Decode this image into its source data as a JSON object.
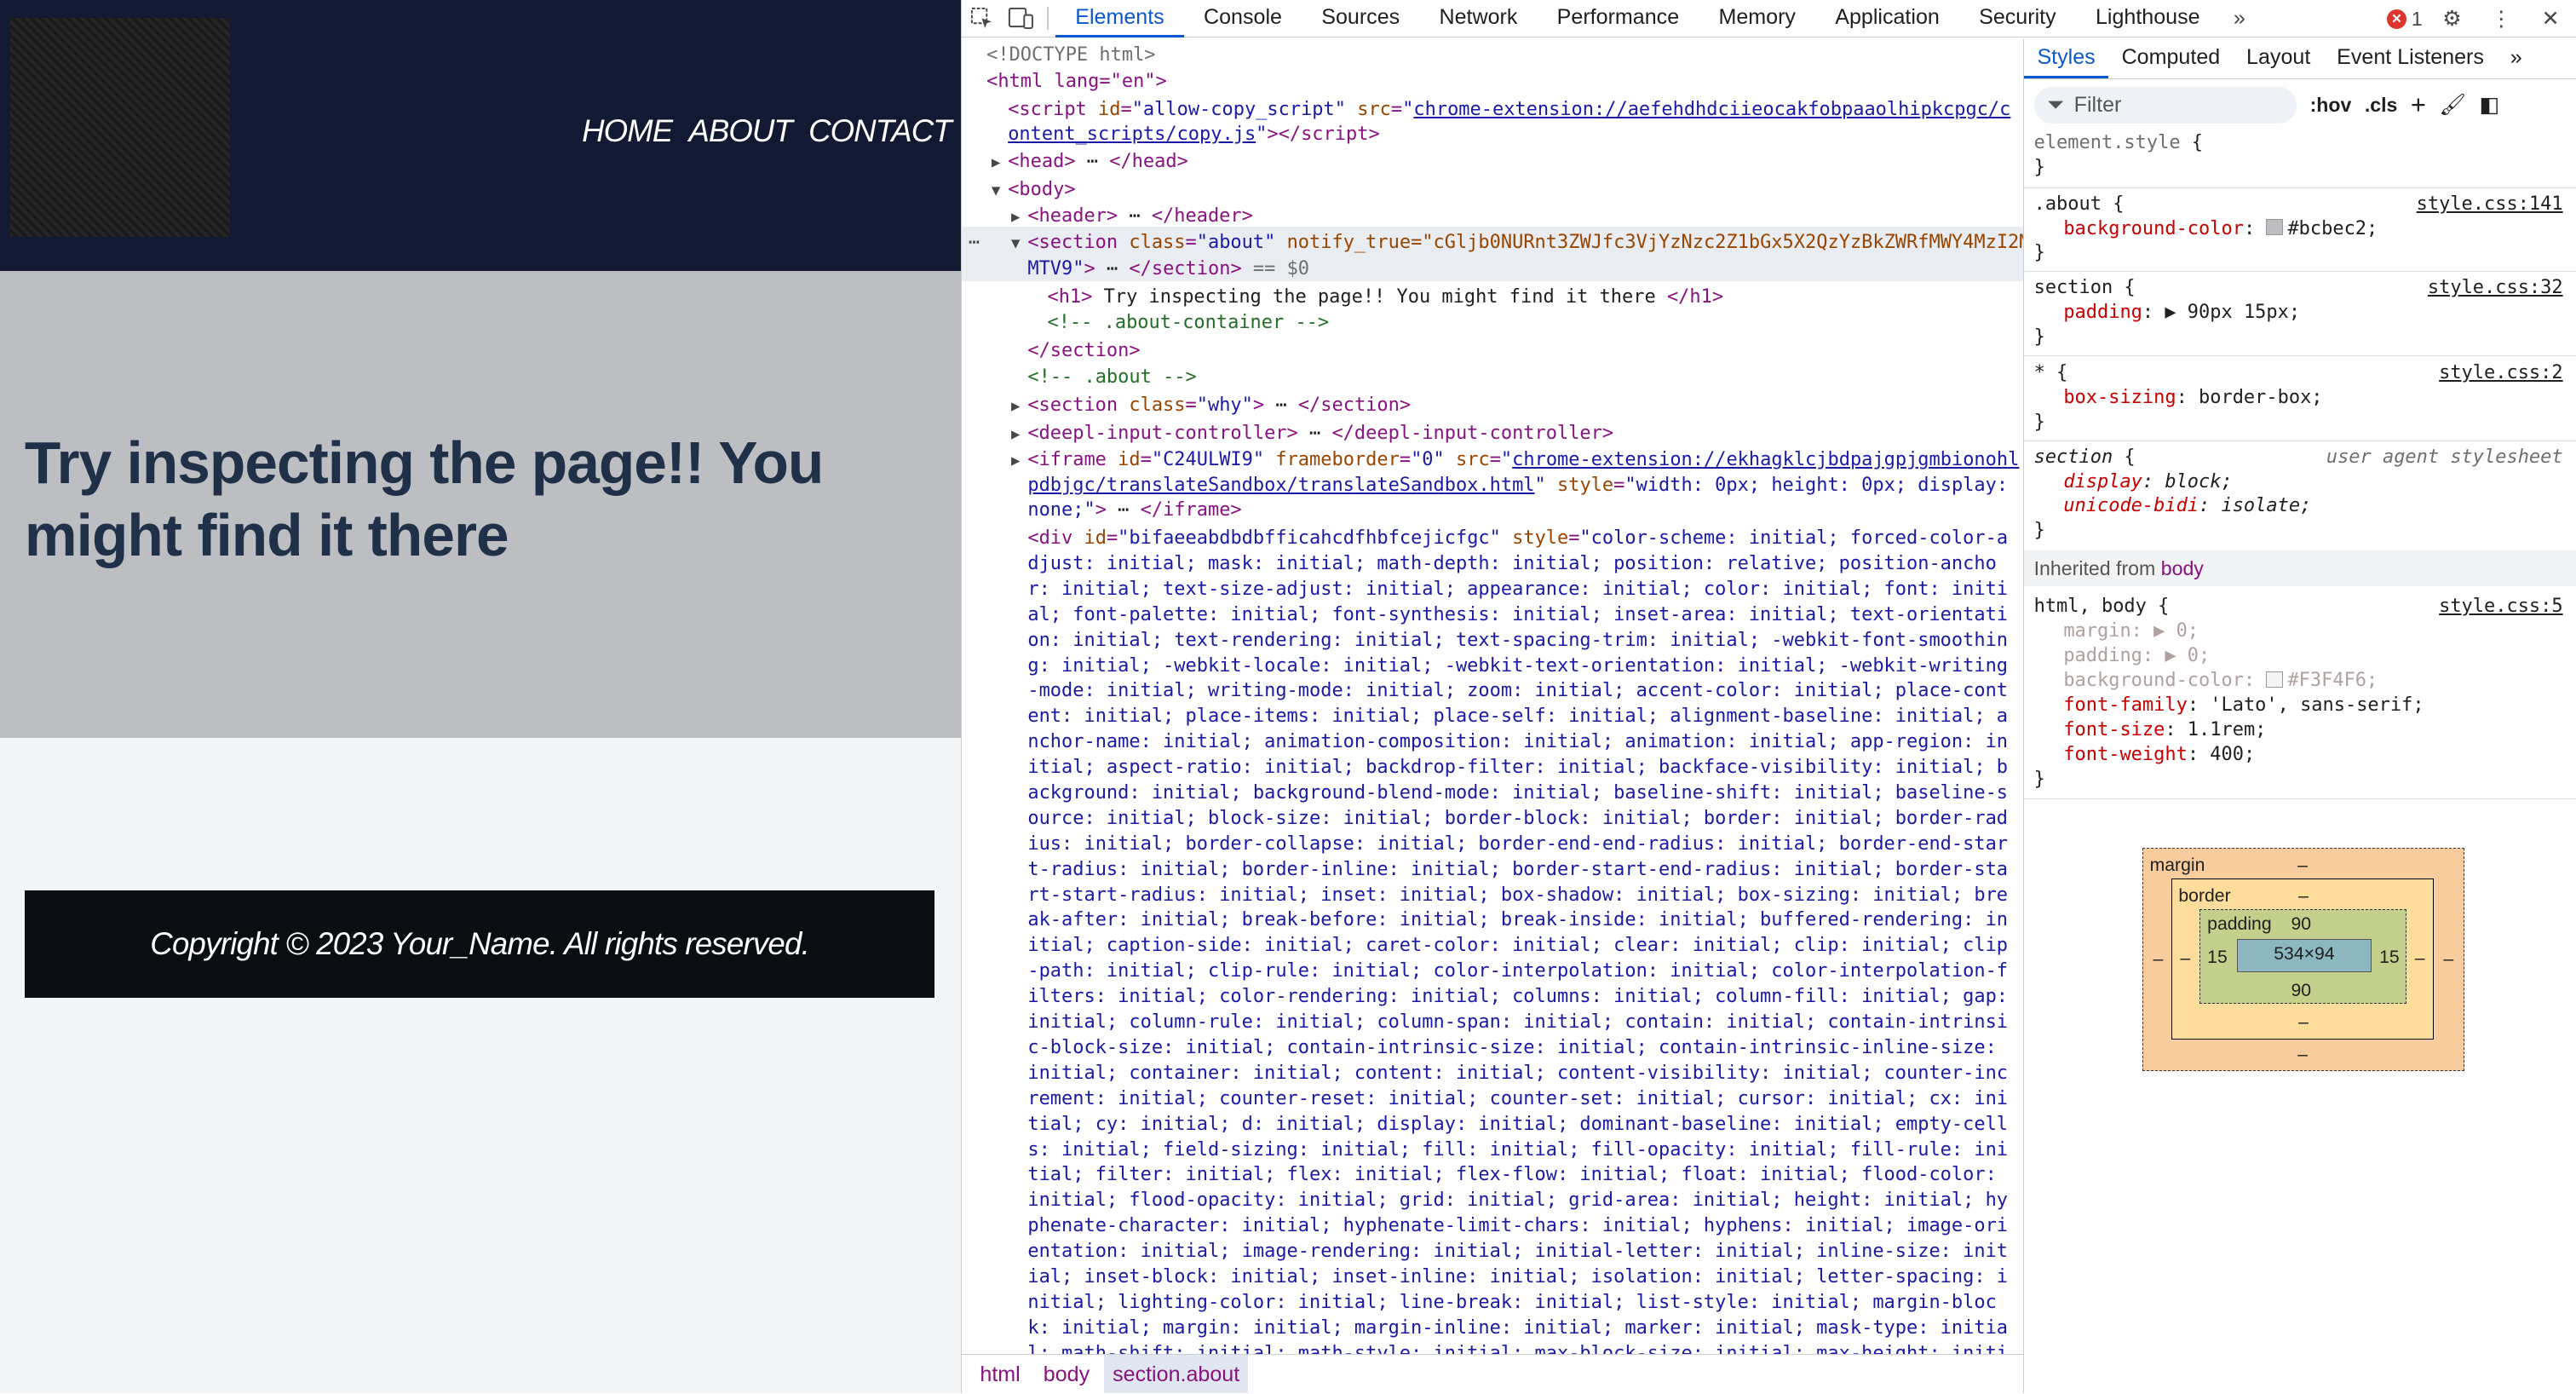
{
  "page": {
    "nav": [
      "HOME",
      "ABOUT",
      "CONTACT"
    ],
    "heading": "Try inspecting the page!! You might find it there",
    "footer": "Copyright © 2023 Your_Name. All rights reserved."
  },
  "devtools": {
    "tabs": [
      "Elements",
      "Console",
      "Sources",
      "Network",
      "Performance",
      "Memory",
      "Application",
      "Security",
      "Lighthouse"
    ],
    "active_tab": "Elements",
    "error_count": "1",
    "dom": {
      "doctype": "<!DOCTYPE html>",
      "html_open": "<html lang=\"en\">",
      "script_src1": "chrome-extension://aefehdhdciieocakfobpaaolhipkcpgc/c",
      "script_src2": "ontent_scripts/copy.js",
      "notify": "notify_true=\"cGljb0NURnt3ZWJfc3VjYzNzc2Z1bGx5X2QzYzBkZWRfMWY4MzI2MTV9\"",
      "h1_text": " Try inspecting the page!! You might find it there ",
      "about_container_comment": "<!-- .about-container -->",
      "about_comment": "<!-- .about -->",
      "iframe_id": "C24ULWI9",
      "iframe_src1": "chrome-extension://ekhagklcjbdpajgpjgmbionohl",
      "iframe_src2": "pdbjgc/translateSandbox/translateSandbox.html",
      "div_id": "bifaeeabdbdbfficahcdfhbfcejicfgc",
      "div_style": "color-scheme: initial; forced-color-adjust: initial; mask: initial; math-depth: initial; position: relative; position-anchor: initial; text-size-adjust: initial; appearance: initial; color: initial; font: initial; font-palette: initial; font-synthesis: initial; inset-area: initial; text-orientation: initial; text-rendering: initial; text-spacing-trim: initial; -webkit-font-smoothing: initial; -webkit-locale: initial; -webkit-text-orientation: initial; -webkit-writing-mode: initial; writing-mode: initial; zoom: initial; accent-color: initial; place-content: initial; place-items: initial; place-self: initial; alignment-baseline: initial; anchor-name: initial; animation-composition: initial; animation: initial; app-region: initial; aspect-ratio: initial; backdrop-filter: initial; backface-visibility: initial; background: initial; background-blend-mode: initial; baseline-shift: initial; baseline-source: initial; block-size: initial; border-block: initial; border: initial; border-radius: initial; border-collapse: initial; border-end-end-radius: initial; border-end-start-radius: initial; border-inline: initial; border-start-end-radius: initial; border-start-start-radius: initial; inset: initial; box-shadow: initial; box-sizing: initial; break-after: initial; break-before: initial; break-inside: initial; buffered-rendering: initial; caption-side: initial; caret-color: initial; clear: initial; clip: initial; clip-path: initial; clip-rule: initial; color-interpolation: initial; color-interpolation-filters: initial; color-rendering: initial; columns: initial; column-fill: initial; gap: initial; column-rule: initial; column-span: initial; contain: initial; contain-intrinsic-block-size: initial; contain-intrinsic-size: initial; contain-intrinsic-inline-size: initial; container: initial; content: initial; content-visibility: initial; counter-increment: initial; counter-reset: initial; counter-set: initial; cursor: initial; cx: initial; cy: initial; d: initial; display: initial; dominant-baseline: initial; empty-cells: initial; field-sizing: initial; fill: initial; fill-opacity: initial; fill-rule: initial; filter: initial; flex: initial; flex-flow: initial; float: initial; flood-color: initial; flood-opacity: initial; grid: initial; grid-area: initial; height: initial; hyphenate-character: initial; hyphenate-limit-chars: initial; hyphens: initial; image-orientation: initial; image-rendering: initial; initial-letter: initial; inline-size: initial; inset-block: initial; inset-inline: initial; isolation: initial; letter-spacing: initial; lighting-color: initial; line-break: initial; list-style: initial; margin-block: initial; margin: initial; margin-inline: initial; marker: initial; mask-type: initial; math-shift: initial; math-style: initial; max-block-size: initial; max-height: initial; max-inline-size: initial; max-width"
    },
    "breadcrumb": [
      "html",
      "body",
      "section.about"
    ],
    "styles": {
      "tabs": [
        "Styles",
        "Computed",
        "Layout",
        "Event Listeners"
      ],
      "filter_placeholder": "Filter",
      "hov": ":hov",
      "cls": ".cls",
      "inherited_label": "Inherited from",
      "inherited_from": "body",
      "about_bg": "#bcbec2",
      "body_bg": "#F3F4F6"
    },
    "box_model": {
      "margin_label": "margin",
      "border_label": "border",
      "padding_label": "padding",
      "margin": "–",
      "border": "–",
      "padding_top": "90",
      "padding_bottom": "90",
      "padding_left": "15",
      "padding_right": "15",
      "content": "534×94"
    }
  }
}
